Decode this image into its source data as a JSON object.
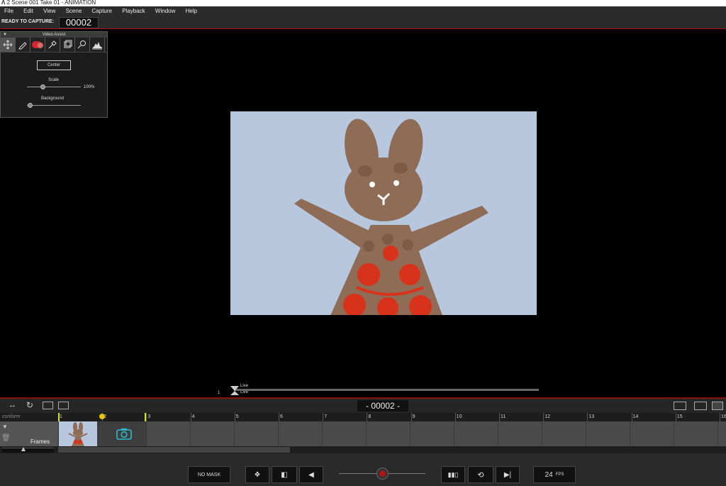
{
  "window": {
    "title": "2  Scene 001  Take 01 - ANIMATION"
  },
  "menu": [
    "File",
    "Edit",
    "View",
    "Scene",
    "Capture",
    "Playback",
    "Window",
    "Help"
  ],
  "capture": {
    "label": "READY TO CAPTURE:",
    "frame": "00002"
  },
  "video_assist": {
    "title": "Video Assist",
    "tools": [
      "move-icon",
      "pencil-icon",
      "onion-skin-icon",
      "eyedropper-icon",
      "crop-icon",
      "magnifier-icon",
      "histogram-icon"
    ],
    "center_label": "Center",
    "scale_label": "Scale",
    "scale_value": "100%",
    "background_label": "Background"
  },
  "live": {
    "top_label": "Live",
    "bottom_label": "Live",
    "frame_start": "1"
  },
  "timeline": {
    "frame_display": "- 00002 -",
    "layer_name": "conform",
    "track_label": "Frames",
    "ruler": [
      "1",
      "2",
      "3",
      "4",
      "5",
      "6",
      "7",
      "8",
      "9",
      "10",
      "11",
      "12",
      "13",
      "14",
      "15",
      "16"
    ]
  },
  "controls": {
    "mask_label": "NO MASK",
    "fps_value": "24",
    "fps_unit": "FPS"
  }
}
